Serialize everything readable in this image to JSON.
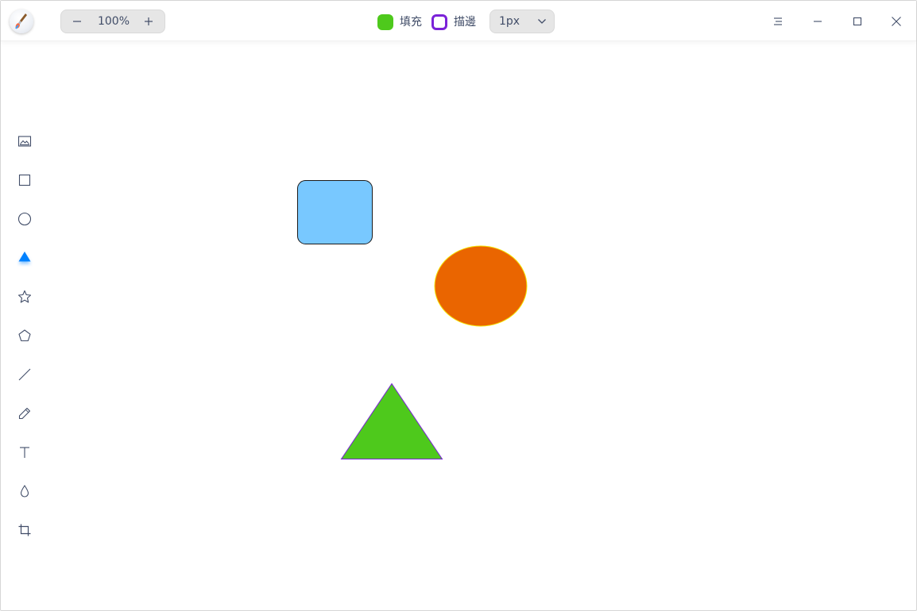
{
  "toolbar": {
    "zoom_value": "100%",
    "zoom_out_icon": "minus-icon",
    "zoom_in_icon": "plus-icon",
    "fill_label": "填充",
    "fill_color": "#4ec91c",
    "stroke_label": "描邊",
    "stroke_color": "#7b22d8",
    "stroke_width": "1px"
  },
  "window_controls": [
    "menu-icon",
    "minimize-icon",
    "maximize-icon",
    "close-icon"
  ],
  "tools": [
    {
      "name": "image",
      "icon": "image-icon",
      "active": false
    },
    {
      "name": "rectangle",
      "icon": "rectangle-icon",
      "active": false
    },
    {
      "name": "ellipse",
      "icon": "ellipse-icon",
      "active": false
    },
    {
      "name": "triangle",
      "icon": "triangle-icon",
      "active": true
    },
    {
      "name": "star",
      "icon": "star-icon",
      "active": false
    },
    {
      "name": "polygon",
      "icon": "pentagon-icon",
      "active": false
    },
    {
      "name": "line",
      "icon": "line-icon",
      "active": false
    },
    {
      "name": "pencil",
      "icon": "pencil-icon",
      "active": false
    },
    {
      "name": "text",
      "icon": "text-icon",
      "active": false
    },
    {
      "name": "blur",
      "icon": "drop-icon",
      "active": false
    },
    {
      "name": "crop",
      "icon": "crop-icon",
      "active": false
    }
  ],
  "colors": {
    "accent": "#0081ff",
    "rectangle_fill": "#78c8ff",
    "rectangle_stroke": "#1a1a1a",
    "ellipse_fill": "#ea6500",
    "ellipse_stroke": "#f5e400",
    "triangle_fill": "#4ec91c",
    "triangle_stroke": "#7b22d8"
  }
}
